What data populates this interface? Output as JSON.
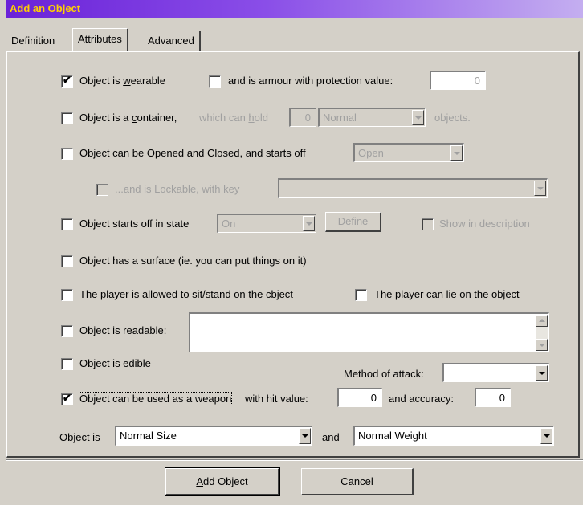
{
  "window": {
    "title": "Add an Object"
  },
  "tabs": [
    "Definition",
    "Attributes",
    "Advanced"
  ],
  "wearable": {
    "checked": true,
    "label_pre": "Object is ",
    "label_u": "w",
    "label_post": "earable"
  },
  "armour": {
    "checked": false,
    "label": "and is armour with protection value:",
    "value": "0"
  },
  "container": {
    "checked": false,
    "label_pre": "Object is a ",
    "label_u": "c",
    "label_post": "ontainer,",
    "hold_pre": "which can ",
    "hold_u": "h",
    "hold_post": "old",
    "count": "0",
    "type": "Normal",
    "suffix": "objects."
  },
  "openclose": {
    "checked": false,
    "label": "Object can be Opened and Closed, and starts off",
    "state": "Open"
  },
  "lockable": {
    "checked": false,
    "label": "...and is Lockable, with key",
    "key": ""
  },
  "startstate": {
    "checked": false,
    "label": "Object starts off in state",
    "state": "On",
    "define_label": "Define",
    "show_label": "Show in description",
    "show_checked": false
  },
  "surface": {
    "checked": false,
    "label": "Object has a surface (ie. you can put things on it)"
  },
  "sitstand": {
    "checked": false,
    "label": "The player is allowed to sit/stand on the cbject"
  },
  "lie": {
    "checked": false,
    "label": "The player can lie on the object"
  },
  "readable": {
    "checked": false,
    "label": "Object is readable:",
    "text": ""
  },
  "edible": {
    "checked": false,
    "label": "Object is edible"
  },
  "attack": {
    "label": "Method of attack:",
    "value": ""
  },
  "weapon": {
    "checked": true,
    "label": "Object can be used as a weapon",
    "hit_label": "with hit value:",
    "hit": "0",
    "acc_label": "and accuracy:",
    "acc": "0"
  },
  "size": {
    "label": "Object is",
    "value": "Normal Size",
    "and_label": "and",
    "weight": "Normal Weight"
  },
  "buttons": {
    "add_pre": "",
    "add_u": "A",
    "add_post": "dd Object",
    "cancel": "Cancel"
  }
}
